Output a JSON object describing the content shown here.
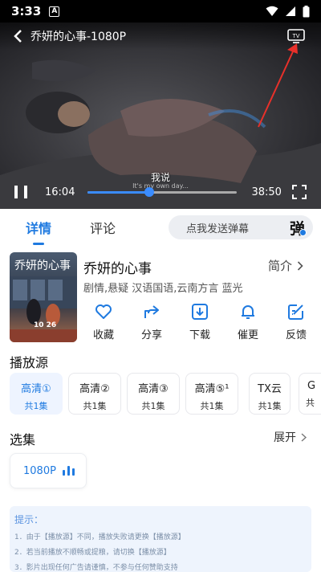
{
  "status": {
    "time": "3:33",
    "notif": "A"
  },
  "player": {
    "title": "乔妍的心事-1080P",
    "subtitle": "我说",
    "subtitle_en": "It's my own day...",
    "current_time": "16:04",
    "duration": "38:50",
    "progress": 0.413
  },
  "tabs": {
    "details": "详情",
    "comments": "评论",
    "danmaku_placeholder": "点我发送弹幕",
    "danmaku_btn": "弹"
  },
  "movie": {
    "poster_title": "乔妍的心事",
    "poster_date": "10 26",
    "name": "乔妍的心事",
    "intro_label": "简介",
    "meta": "剧情,悬疑 汉语国语,云南方言 蓝光"
  },
  "actions": [
    {
      "label": "收藏",
      "icon": "heart-icon"
    },
    {
      "label": "分享",
      "icon": "share-icon"
    },
    {
      "label": "下载",
      "icon": "download-icon"
    },
    {
      "label": "催更",
      "icon": "bell-icon"
    },
    {
      "label": "反馈",
      "icon": "feedback-icon"
    }
  ],
  "sources_title": "播放源",
  "sources": [
    {
      "name": "高清①",
      "count": "共1集"
    },
    {
      "name": "高清②",
      "count": "共1集"
    },
    {
      "name": "高清③",
      "count": "共1集"
    },
    {
      "name": "高清⑤¹",
      "count": "共1集"
    },
    {
      "name": "TX云",
      "count": "共1集"
    },
    {
      "name": "G",
      "count": "共"
    }
  ],
  "episodes_title": "选集",
  "expand_label": "展开",
  "episode": "1080P",
  "tips": {
    "heading": "提示：",
    "lines": [
      "1．由于【播放源】不同，播放失败请更换【播放源】",
      "2．若当前播放不顺畅或提粮，请切换【播放源】",
      "3．影片出现任何广告请谨慎，不参与任何赞助支持"
    ]
  },
  "colors": {
    "accent": "#1f7ae0",
    "annotation_arrow": "#e8302a"
  }
}
